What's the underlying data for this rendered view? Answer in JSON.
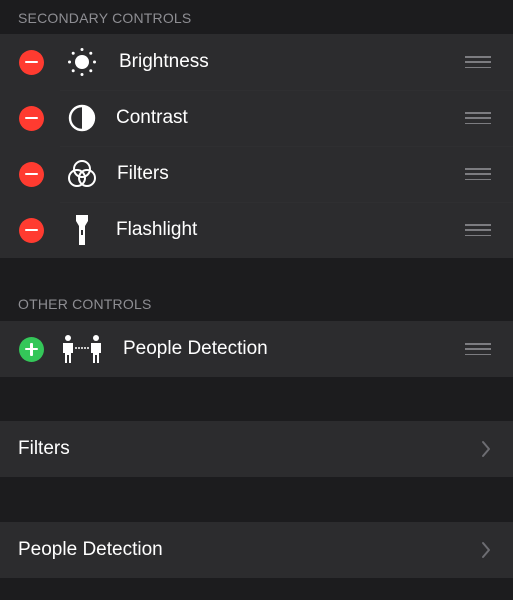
{
  "secondary_section": {
    "header": "SECONDARY CONTROLS",
    "items": [
      {
        "label": "Brightness",
        "icon": "sun-icon"
      },
      {
        "label": "Contrast",
        "icon": "contrast-icon"
      },
      {
        "label": "Filters",
        "icon": "filters-icon"
      },
      {
        "label": "Flashlight",
        "icon": "flashlight-icon"
      }
    ]
  },
  "other_section": {
    "header": "OTHER CONTROLS",
    "items": [
      {
        "label": "People Detection",
        "icon": "people-detection-icon"
      }
    ]
  },
  "nav_rows": [
    {
      "label": "Filters"
    },
    {
      "label": "People Detection"
    }
  ],
  "colors": {
    "background": "#1c1c1e",
    "row_background": "#2c2c2e",
    "remove": "#ff3b30",
    "add": "#34c759",
    "secondary_text": "#8e8e93"
  }
}
